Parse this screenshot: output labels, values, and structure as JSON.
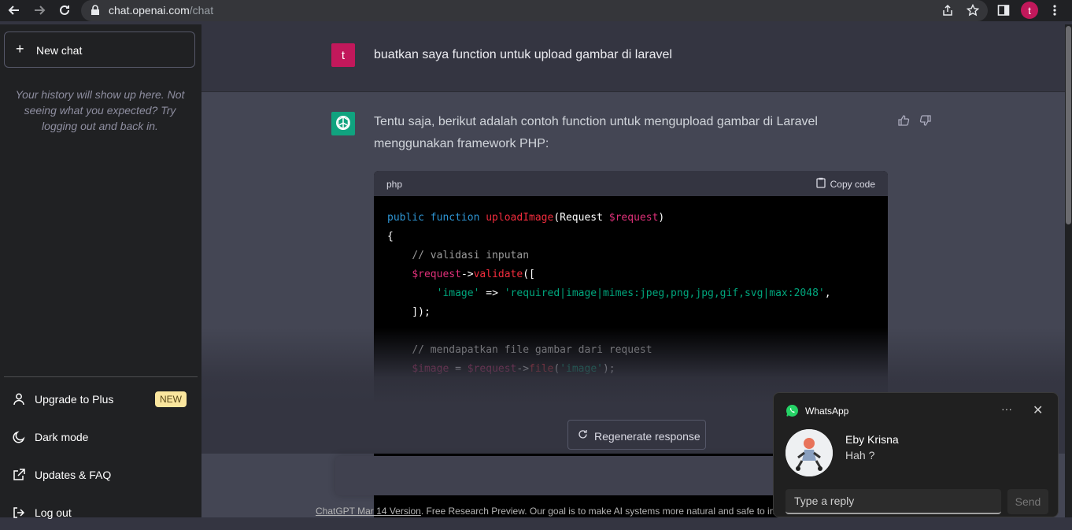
{
  "browser": {
    "url_host": "chat.openai.com",
    "url_path": "/chat",
    "profile_initial": "t"
  },
  "sidebar": {
    "new_chat": "New chat",
    "history_note": "Your history will show up here. Not seeing what you expected? Try logging out and back in.",
    "items": [
      {
        "label": "Upgrade to Plus",
        "badge": "NEW",
        "icon": "user-icon"
      },
      {
        "label": "Dark mode",
        "icon": "moon-icon"
      },
      {
        "label": "Updates & FAQ",
        "icon": "external-link-icon"
      },
      {
        "label": "Log out",
        "icon": "logout-icon"
      }
    ]
  },
  "conversation": {
    "user_initial": "t",
    "user_message": "buatkan saya function untuk upload gambar di laravel",
    "assistant_message": "Tentu saja, berikut adalah contoh function untuk mengupload gambar di Laravel menggunakan framework PHP:",
    "code": {
      "language": "php",
      "copy_label": "Copy code"
    }
  },
  "regenerate_label": "Regenerate response",
  "footer": {
    "version_link": "ChatGPT Mar 14 Version",
    "note": ". Free Research Preview. Our goal is to make AI systems more natural and safe to inter"
  },
  "whatsapp": {
    "app": "WhatsApp",
    "more": "···",
    "close": "✕",
    "sender": "Eby Krisna",
    "message": "Hah ?",
    "reply_placeholder": "Type a reply",
    "send": "Send"
  },
  "colors": {
    "accent_green": "#10a37f",
    "user_avatar": "#c2185b",
    "badge_new": "#fae69e"
  }
}
